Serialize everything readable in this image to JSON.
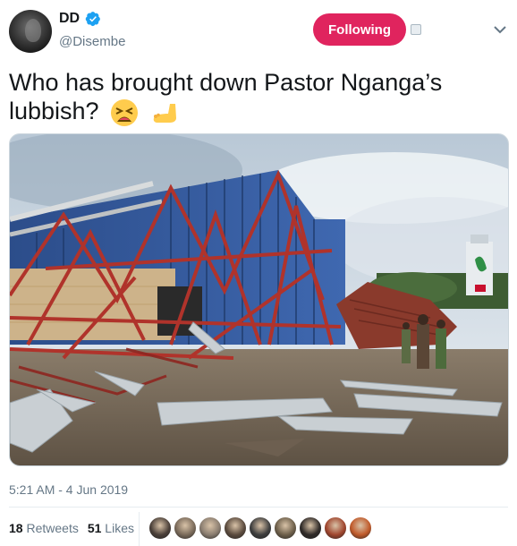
{
  "user": {
    "display_name": "DD",
    "handle": "@Disembe",
    "verified": true
  },
  "follow_button": {
    "label": "Following",
    "color": "#e0245e"
  },
  "tweet": {
    "text": "Who has brought down Pastor Nganga’s lubbish?",
    "emojis": [
      "tired-face-emoji",
      "foot-emoji"
    ]
  },
  "photo": {
    "subject": "collapsed church structure with twisted red steel frame and blue roofing sheets"
  },
  "timestamp": "5:21 AM - 4 Jun 2019",
  "stats": {
    "retweets_count": "18",
    "retweets_label": "Retweets",
    "likes_count": "51",
    "likes_label": "Likes"
  },
  "likers": [
    {
      "color": "#4a3f38"
    },
    {
      "color": "#7a6a5a"
    },
    {
      "color": "#8a7d70"
    },
    {
      "color": "#5b4b3e"
    },
    {
      "color": "#3e3e3e"
    },
    {
      "color": "#6d5f4a"
    },
    {
      "color": "#2f2a28"
    },
    {
      "color": "#a0462e"
    },
    {
      "color": "#c05a2a"
    }
  ]
}
